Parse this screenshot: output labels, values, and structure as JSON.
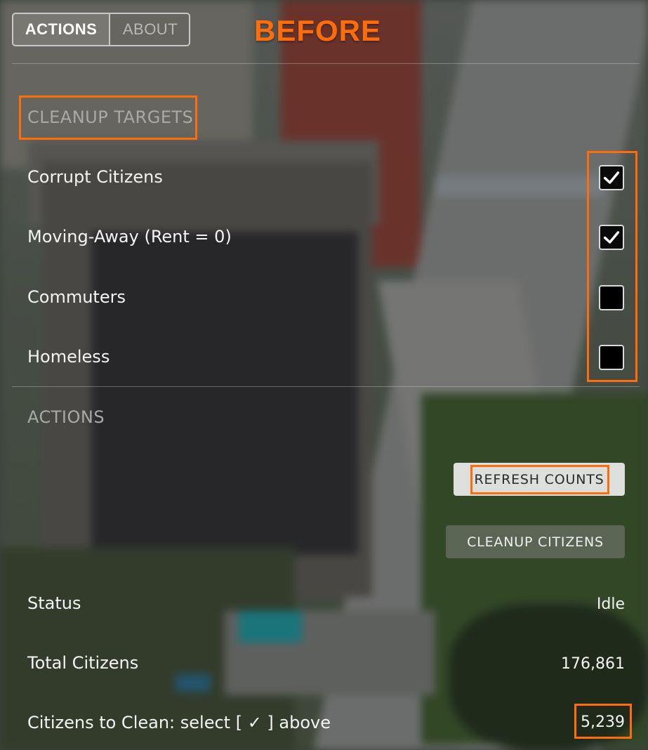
{
  "tabs": [
    {
      "label": "ACTIONS",
      "active": true
    },
    {
      "label": "ABOUT",
      "active": false
    }
  ],
  "annotation_label": "BEFORE",
  "cleanup_targets": {
    "title": "CLEANUP TARGETS",
    "items": [
      {
        "label": "Corrupt Citizens",
        "checked": true
      },
      {
        "label": "Moving-Away (Rent = 0)",
        "checked": true
      },
      {
        "label": "Commuters",
        "checked": false
      },
      {
        "label": "Homeless",
        "checked": false
      }
    ]
  },
  "actions": {
    "title": "ACTIONS",
    "refresh_button": "REFRESH COUNTS",
    "cleanup_button": "CLEANUP CITIZENS"
  },
  "stats": {
    "status_label": "Status",
    "status_value": "Idle",
    "total_label": "Total Citizens",
    "total_value": "176,861",
    "to_clean_label": "Citizens to Clean: select [ ✓ ] above",
    "to_clean_value": "5,239"
  },
  "colors": {
    "highlight": "#ff6d0a",
    "section_title": "#a9a9a9"
  }
}
